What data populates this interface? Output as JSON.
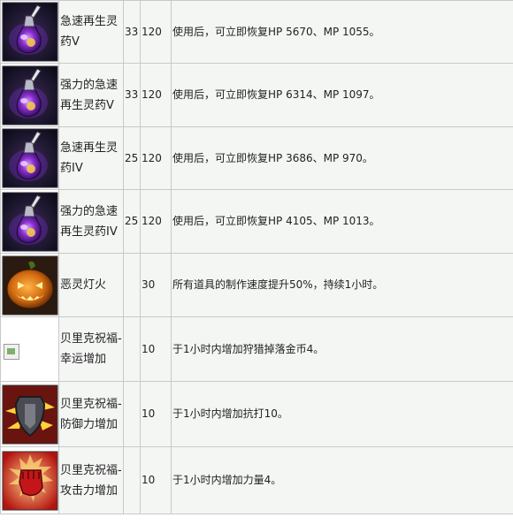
{
  "items": [
    {
      "icon": "purple-potion-icon",
      "name": "急速再生灵药V",
      "level": "33",
      "duration": "120",
      "description": "使用后，可立即恢复HP 5670、MP 1055。"
    },
    {
      "icon": "purple-potion-icon",
      "name": "强力的急速再生灵药V",
      "level": "33",
      "duration": "120",
      "description": "使用后，可立即恢复HP 6314、MP 1097。"
    },
    {
      "icon": "purple-potion-icon",
      "name": "急速再生灵药IV",
      "level": "25",
      "duration": "120",
      "description": "使用后，可立即恢复HP 3686、MP 970。"
    },
    {
      "icon": "purple-potion-icon",
      "name": "强力的急速再生灵药IV",
      "level": "25",
      "duration": "120",
      "description": "使用后，可立即恢复HP 4105、MP 1013。"
    },
    {
      "icon": "jack-o-lantern-icon",
      "name": "恶灵灯火",
      "level": "",
      "duration": "30",
      "description": "所有道具的制作速度提升50%，持续1小时。"
    },
    {
      "icon": "broken-image-icon",
      "name": "贝里克祝福- 幸运增加",
      "level": "",
      "duration": "10",
      "description": "于1小时内增加狩猎掉落金币4。"
    },
    {
      "icon": "shield-buff-icon",
      "name": "贝里克祝福- 防御力增加",
      "level": "",
      "duration": "10",
      "description": "于1小时内增加抗打10。"
    },
    {
      "icon": "fist-buff-icon",
      "name": "贝里克祝福- 攻击力增加",
      "level": "",
      "duration": "10",
      "description": "于1小时内增加力量4。"
    }
  ]
}
